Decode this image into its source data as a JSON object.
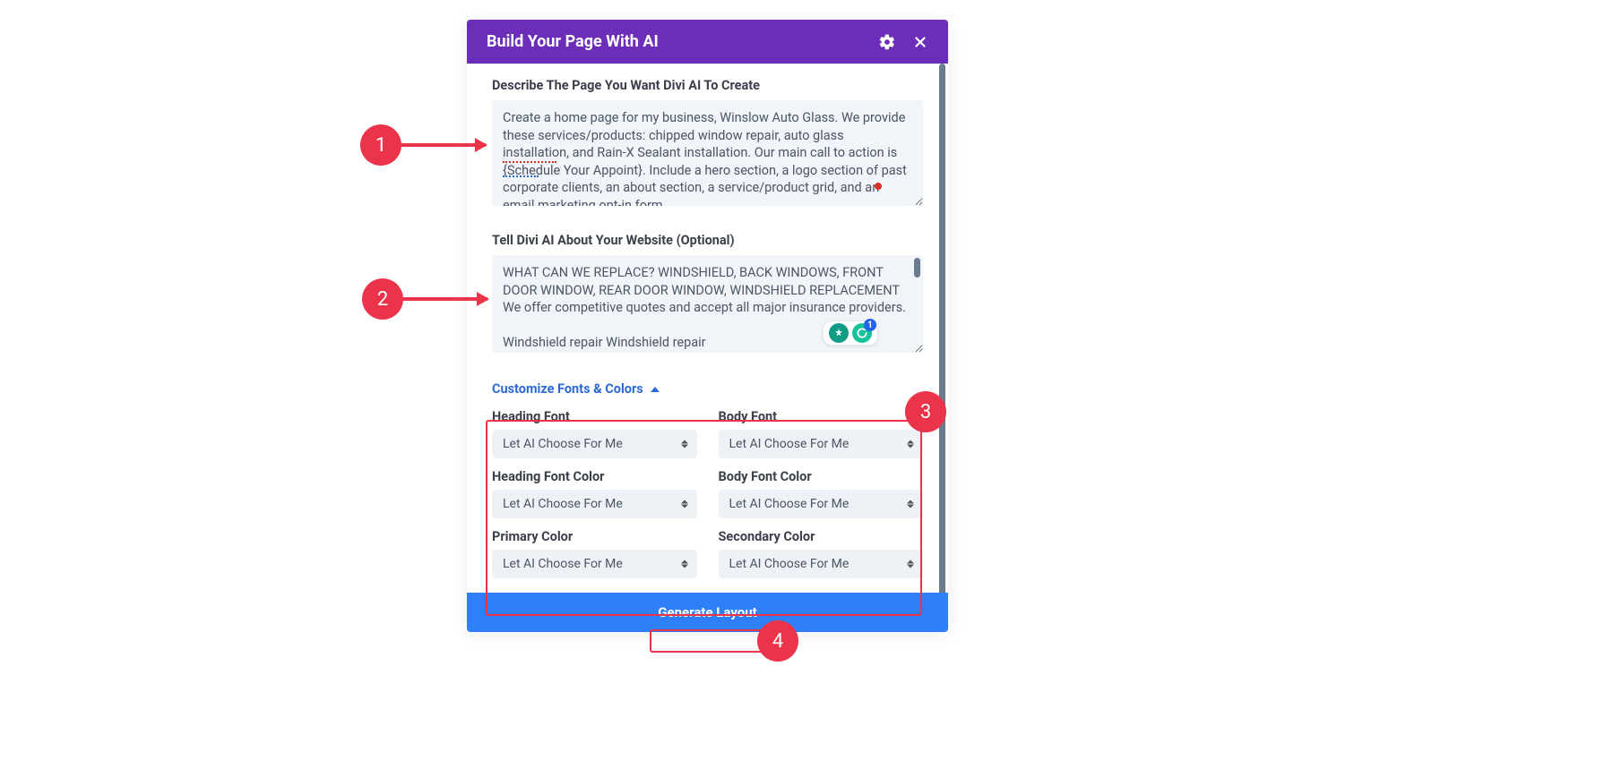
{
  "header": {
    "title": "Build Your Page With AI"
  },
  "section1": {
    "label": "Describe The Page You Want Divi AI To Create",
    "text": "Create a home page for my business, Winslow Auto Glass. We provide these services/products: chipped window repair, auto glass installation, and Rain-X Sealant installation. Our main call to action is {Schedule Your Appoint}. Include a hero section, a logo section of past corporate clients, an about section, a service/product grid, and an email marketing opt-in form."
  },
  "section2": {
    "label": "Tell Divi AI About Your Website (Optional)",
    "text": "WHAT CAN WE REPLACE? WINDSHIELD, BACK WINDOWS, FRONT DOOR WINDOW, REAR DOOR WINDOW, WINDSHIELD REPLACEMENT We offer competitive quotes and accept all major insurance providers.\n\nWindshield repair Windshield repair"
  },
  "customize": {
    "toggle_label": "Customize Fonts & Colors",
    "fields": {
      "heading_font": {
        "label": "Heading Font",
        "value": "Let AI Choose For Me"
      },
      "body_font": {
        "label": "Body Font",
        "value": "Let AI Choose For Me"
      },
      "heading_font_color": {
        "label": "Heading Font Color",
        "value": "Let AI Choose For Me"
      },
      "body_font_color": {
        "label": "Body Font Color",
        "value": "Let AI Choose For Me"
      },
      "primary_color": {
        "label": "Primary Color",
        "value": "Let AI Choose For Me"
      },
      "secondary_color": {
        "label": "Secondary Color",
        "value": "Let AI Choose For Me"
      }
    }
  },
  "footer": {
    "generate_label": "Generate Layout"
  },
  "annotations": {
    "n1": "1",
    "n2": "2",
    "n3": "3",
    "n4": "4"
  },
  "grammarly": {
    "badge_count": "1"
  }
}
